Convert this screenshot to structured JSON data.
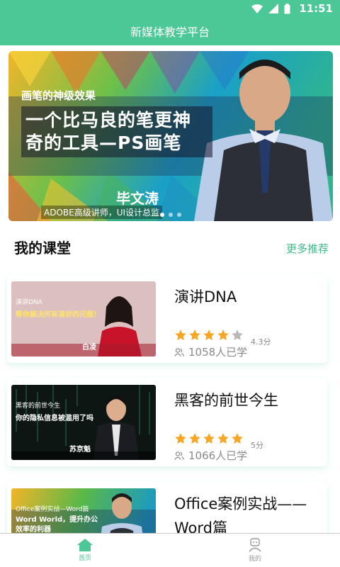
{
  "status_bar": {
    "time": "11:51"
  },
  "app_bar": {
    "title": "新媒体教学平台"
  },
  "banner": {
    "kicker": "画笔的神级效果",
    "headline": "一个比马良的笔更神奇的工具—PS画笔",
    "speaker": "毕文涛",
    "credential": "ADOBE高级讲师，UI设计总监"
  },
  "section": {
    "title": "我的课堂",
    "more_label": "更多推荐"
  },
  "courses": [
    {
      "thumb_line1": "演讲DNA",
      "thumb_line2": "帮你解决所有演讲的问题！",
      "thumb_name": "白凌",
      "name": "演讲DNA",
      "stars": 4,
      "rating": "4.3分",
      "learners": "1058人已学"
    },
    {
      "thumb_line1": "黑客的前世今生",
      "thumb_line2": "你的隐私信息被滥用了吗",
      "thumb_name": "苏京魁",
      "name": "黑客的前世今生",
      "stars": 5,
      "rating": "5分",
      "learners": "1066人已学"
    },
    {
      "thumb_line1": "Office案例实战—Word篇",
      "thumb_line2": "Word World，提升办公效率的利器",
      "thumb_name": "",
      "name": "Office案例实战——Word篇",
      "stars": 0,
      "rating": "",
      "learners": ""
    }
  ],
  "tabbar": {
    "home_label": "首页",
    "mine_label": "我的"
  },
  "colors": {
    "accent": "#4cc796",
    "star": "#f6a623",
    "star_empty": "#b8b8b8"
  }
}
